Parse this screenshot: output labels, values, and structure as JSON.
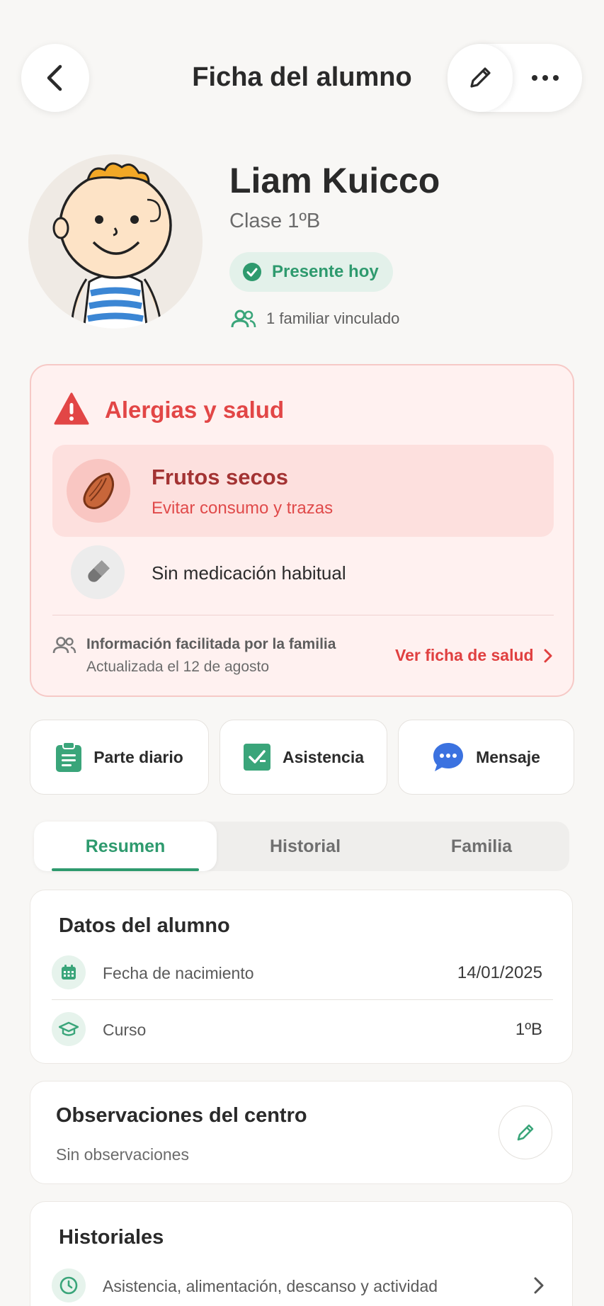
{
  "header": {
    "title": "Ficha del alumno",
    "back_icon": "chevron-left-icon",
    "edit_icon": "pencil-icon",
    "more_icon": "more-horizontal-icon"
  },
  "profile": {
    "name": "Liam Kuicco",
    "class": "Clase 1ºB",
    "status": "Presente hoy",
    "family_linked": "1 familiar vinculado"
  },
  "health": {
    "title": "Alergias y salud",
    "allergy": {
      "name": "Frutos secos",
      "note": "Evitar consumo y trazas"
    },
    "medication": "Sin medicación habitual",
    "source": "Información facilitada por la familia",
    "updated": "Actualizada el 12 de agosto",
    "link_label": "Ver ficha de salud"
  },
  "quick_actions": [
    {
      "label": "Parte diario",
      "icon": "clipboard-icon"
    },
    {
      "label": "Asistencia",
      "icon": "checkbox-icon"
    },
    {
      "label": "Mensaje",
      "icon": "chat-bubble-icon"
    }
  ],
  "tabs": [
    {
      "label": "Resumen",
      "active": true
    },
    {
      "label": "Historial",
      "active": false
    },
    {
      "label": "Familia",
      "active": false
    }
  ],
  "student_data": {
    "title": "Datos del alumno",
    "rows": [
      {
        "label": "Fecha de nacimiento",
        "value": "14/01/2025",
        "icon": "calendar-icon"
      },
      {
        "label": "Curso",
        "value": "1ºB",
        "icon": "graduation-cap-icon"
      }
    ]
  },
  "observations": {
    "title": "Observaciones del centro",
    "text": "Sin observaciones"
  },
  "histories": {
    "title": "Historiales",
    "row_label": "Asistencia, alimentación, descanso y actividad"
  },
  "colors": {
    "accent": "#2e9a6e",
    "danger": "#e24646",
    "background": "#f8f7f5"
  }
}
